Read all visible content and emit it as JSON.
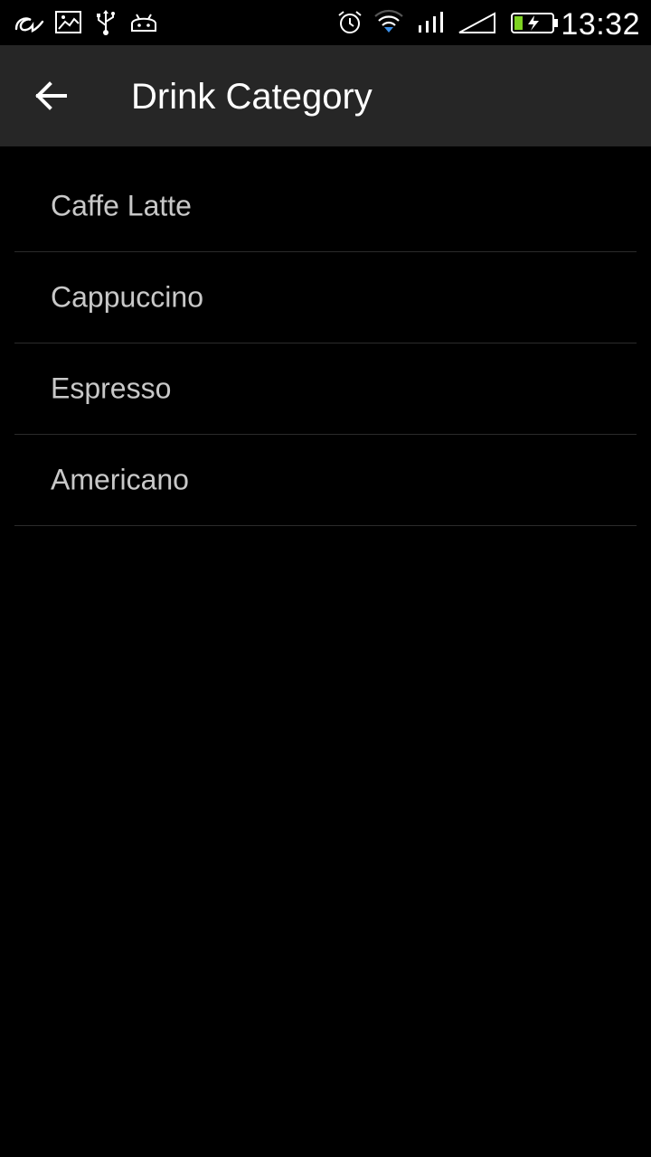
{
  "status_bar": {
    "time": "13:32",
    "left_icons": [
      "aliwangwang-icon",
      "image-icon",
      "usb-icon",
      "android-debug-icon"
    ],
    "right_icons": [
      "alarm-icon",
      "wifi-icon",
      "cell-signal-icon",
      "signal-triangle-icon",
      "battery-charging-icon"
    ],
    "battery_color": "#7ed321"
  },
  "header": {
    "title": "Drink Category",
    "back_icon": "arrow-back-icon"
  },
  "categories": [
    {
      "label": "Caffe Latte"
    },
    {
      "label": "Cappuccino"
    },
    {
      "label": "Espresso"
    },
    {
      "label": "Americano"
    }
  ]
}
